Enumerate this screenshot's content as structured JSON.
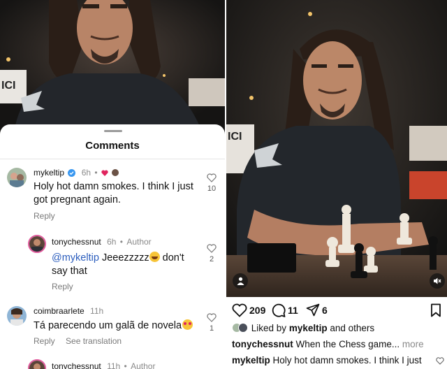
{
  "comments_sheet": {
    "title": "Comments",
    "comments": [
      {
        "username": "mykeltip",
        "time": "6h",
        "text": "Holy hot damn smokes. I think I just got pregnant again.",
        "reply_label": "Reply",
        "like_count": "10"
      },
      {
        "username": "tonychessnut",
        "time": "6h",
        "author_tag": "Author",
        "mention": "@mykeltip",
        "text": "Jeeezzzzz",
        "text2": "don't say that",
        "reply_label": "Reply",
        "like_count": "2"
      },
      {
        "username": "coimbraarlete",
        "time": "11h",
        "text": "Tá parecendo um galã de novela",
        "reply_label": "Reply",
        "translate_label": "See translation",
        "like_count": "1"
      },
      {
        "username": "tonychessnut",
        "time": "11h",
        "author_tag": "Author"
      }
    ]
  },
  "post": {
    "like_count": "209",
    "comment_count": "11",
    "share_count": "6",
    "liked_by_prefix": "Liked by",
    "liked_by_user": "mykeltip",
    "liked_by_suffix": "and others",
    "caption_user": "tonychessnut",
    "caption_text": "When the Chess game...",
    "more_label": "more",
    "preview_user": "mykeltip",
    "preview_text": "Holy hot damn smokes. I think I just"
  },
  "colors": {
    "mention": "#2b5dbd",
    "heart_red": "#e0245e",
    "verified_blue": "#3897f0"
  }
}
